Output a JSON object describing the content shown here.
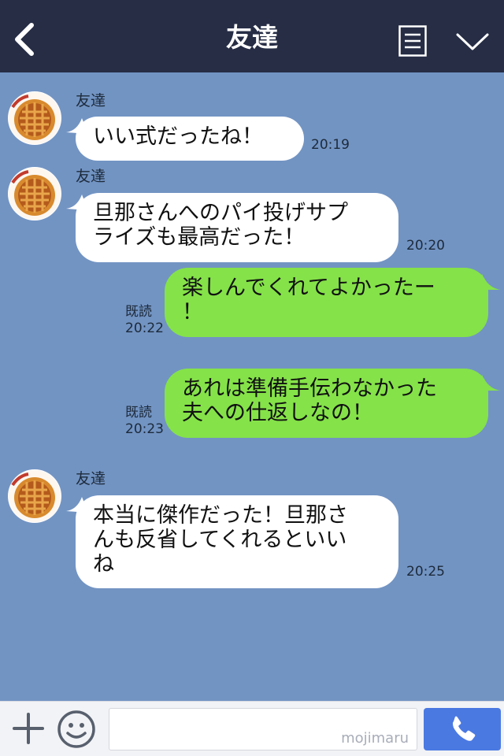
{
  "header": {
    "title": "友達",
    "back_icon": "chevron-left-icon",
    "menu_icon": "notes-menu-icon",
    "collapse_icon": "chevron-down-icon"
  },
  "colors": {
    "header_bg": "#262d45",
    "chat_bg": "#7294c3",
    "incoming_bubble": "#ffffff",
    "outgoing_bubble": "#85e249",
    "call_button": "#4a79e2"
  },
  "messages": [
    {
      "direction": "in",
      "sender": "友達",
      "lines": [
        "いい式だったね！"
      ],
      "time": "20:19"
    },
    {
      "direction": "in",
      "sender": "友達",
      "lines": [
        "旦那さんへのパイ投げサプ",
        "ライズも最高だった！"
      ],
      "time": "20:20"
    },
    {
      "direction": "out",
      "read": "既読",
      "lines": [
        "楽しんでくれてよかったー",
        "！"
      ],
      "time": "20:22"
    },
    {
      "direction": "out",
      "read": "既読",
      "lines": [
        "あれは準備手伝わなかった",
        "夫への仕返しなの！"
      ],
      "time": "20:23"
    },
    {
      "direction": "in",
      "sender": "友達",
      "lines": [
        "本当に傑作だった！旦那さ",
        "んも反省してくれるといい",
        "ね"
      ],
      "time": "20:25"
    }
  ],
  "footer": {
    "plus_icon": "plus-icon",
    "emoji_icon": "smiley-icon",
    "input_value": "",
    "watermark": "mojimaru",
    "call_icon": "phone-icon"
  }
}
